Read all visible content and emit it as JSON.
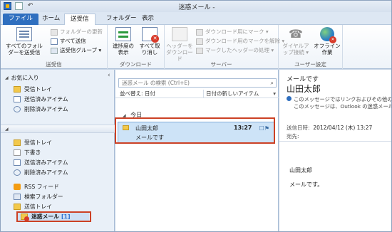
{
  "window": {
    "title": "迷惑メール -",
    "quick_access": [
      "app-icon",
      "send-receive-icon",
      "undo-icon"
    ]
  },
  "ribbon": {
    "tabs": [
      "ファイル",
      "ホーム",
      "送受信",
      "フォルダー",
      "表示"
    ],
    "active_tab": "送受信",
    "groups": {
      "send_receive": {
        "label": "送受信",
        "send_all_folders": "すべてのフォルダーを送受信",
        "update_folder": "フォルダーの更新",
        "send_all": "すべて送信",
        "send_receive_groups": "送受信グループ ▾"
      },
      "download": {
        "label": "ダウンロード",
        "show_progress": "進捗度の表示",
        "cancel_all": "すべて取り消し"
      },
      "server": {
        "label": "サーバー",
        "download_headers": "ヘッダーをダウンロード",
        "mark_to_download": "ダウンロード用にマーク ▾",
        "unmark_download": "ダウンロード用のマークを解除 ▾",
        "process_marked_headers": "マークしたヘッダーの処理 ▾"
      },
      "preferences": {
        "label": "ユーザー設定",
        "dial_up": "ダイヤルアップ接続 ▾",
        "work_offline": "オフライン作業"
      }
    }
  },
  "nav": {
    "favorites_label": "お気に入り",
    "favorites": [
      {
        "label": "受信トレイ",
        "icon": "inbox-icon"
      },
      {
        "label": "送信済みアイテム",
        "icon": "sent-icon"
      },
      {
        "label": "削除済みアイテム",
        "icon": "deleted-icon"
      }
    ],
    "folders": [
      {
        "label": "受信トレイ",
        "icon": "inbox-icon"
      },
      {
        "label": "下書き",
        "icon": "drafts-icon"
      },
      {
        "label": "送信済みアイテム",
        "icon": "sent-icon"
      },
      {
        "label": "削除済みアイテム",
        "icon": "deleted-icon"
      },
      {
        "label": "RSS フィード",
        "icon": "rss-icon"
      },
      {
        "label": "検索フォルダー",
        "icon": "search-folder-icon"
      },
      {
        "label": "送信トレイ",
        "icon": "outbox-icon"
      }
    ],
    "junk": {
      "label": "迷惑メール",
      "count": "[1]"
    }
  },
  "list": {
    "search_placeholder": "迷惑メール の検索 (Ctrl+E)",
    "sort_by": "並べ替え: 日付",
    "sort_order": "日付の新しいアイテム",
    "group_header": "今日",
    "message": {
      "from": "山田太郎",
      "time": "13:27",
      "subject": "メールです"
    }
  },
  "reading": {
    "subject": "メールです",
    "from": "山田太郎",
    "info_line1": "このメッセージではリンクおよびその他の機能",
    "info_line2": "このメッセージは、Outlook の迷惑メール",
    "sent_label": "送信日時:",
    "sent_value": "2012/04/12 (木) 13:27",
    "to_label": "宛先:",
    "body_line1": "山田太郎",
    "body_line2": "メールです。"
  },
  "colors": {
    "accent": "#2f6fbf",
    "selection": "#cde3f7",
    "callout": "#cc4125"
  }
}
